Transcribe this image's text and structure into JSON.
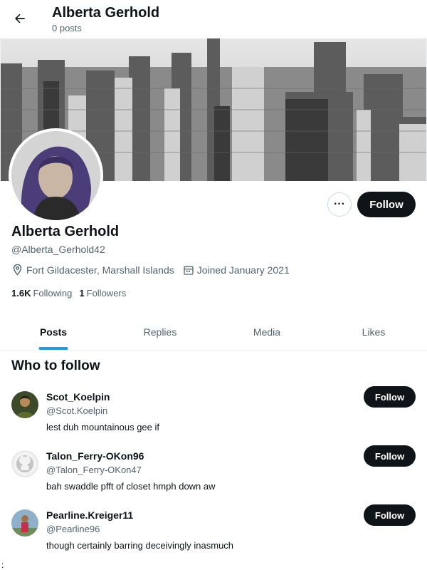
{
  "header": {
    "title": "Alberta Gerhold",
    "subtitle": "0 posts"
  },
  "profile": {
    "display_name": "Alberta Gerhold",
    "handle": "@Alberta_Gerhold42",
    "location": "Fort Gildacester, Marshall Islands",
    "joined": "Joined January 2021",
    "following_count": "1.6K",
    "following_label": "Following",
    "followers_count": "1",
    "followers_label": "Followers",
    "more_label": "···",
    "follow_label": "Follow"
  },
  "tabs": [
    {
      "label": "Posts",
      "active": true
    },
    {
      "label": "Replies",
      "active": false
    },
    {
      "label": "Media",
      "active": false
    },
    {
      "label": "Likes",
      "active": false
    }
  ],
  "who_to_follow": {
    "title": "Who to follow",
    "items": [
      {
        "name": "Scot_Koelpin",
        "handle": "@Scot.Koelpin",
        "bio": "lest duh mountainous gee if",
        "follow_label": "Follow",
        "avatar": "photo-avatar"
      },
      {
        "name": "Talon_Ferry-OKon96",
        "handle": "@Talon_Ferry-OKon47",
        "bio": "bah swaddle pfft of closet hmph down aw",
        "follow_label": "Follow",
        "avatar": "github-avatar"
      },
      {
        "name": "Pearline.Kreiger11",
        "handle": "@Pearline96",
        "bio": "though certainly barring deceivingly inasmuch",
        "follow_label": "Follow",
        "avatar": "photo-avatar"
      }
    ]
  },
  "footer": {
    "stray_glyph": ":"
  },
  "colors": {
    "accent": "#1d9bf0",
    "text": "#0f1419",
    "muted": "#536471",
    "button_dark": "#0f1419"
  }
}
